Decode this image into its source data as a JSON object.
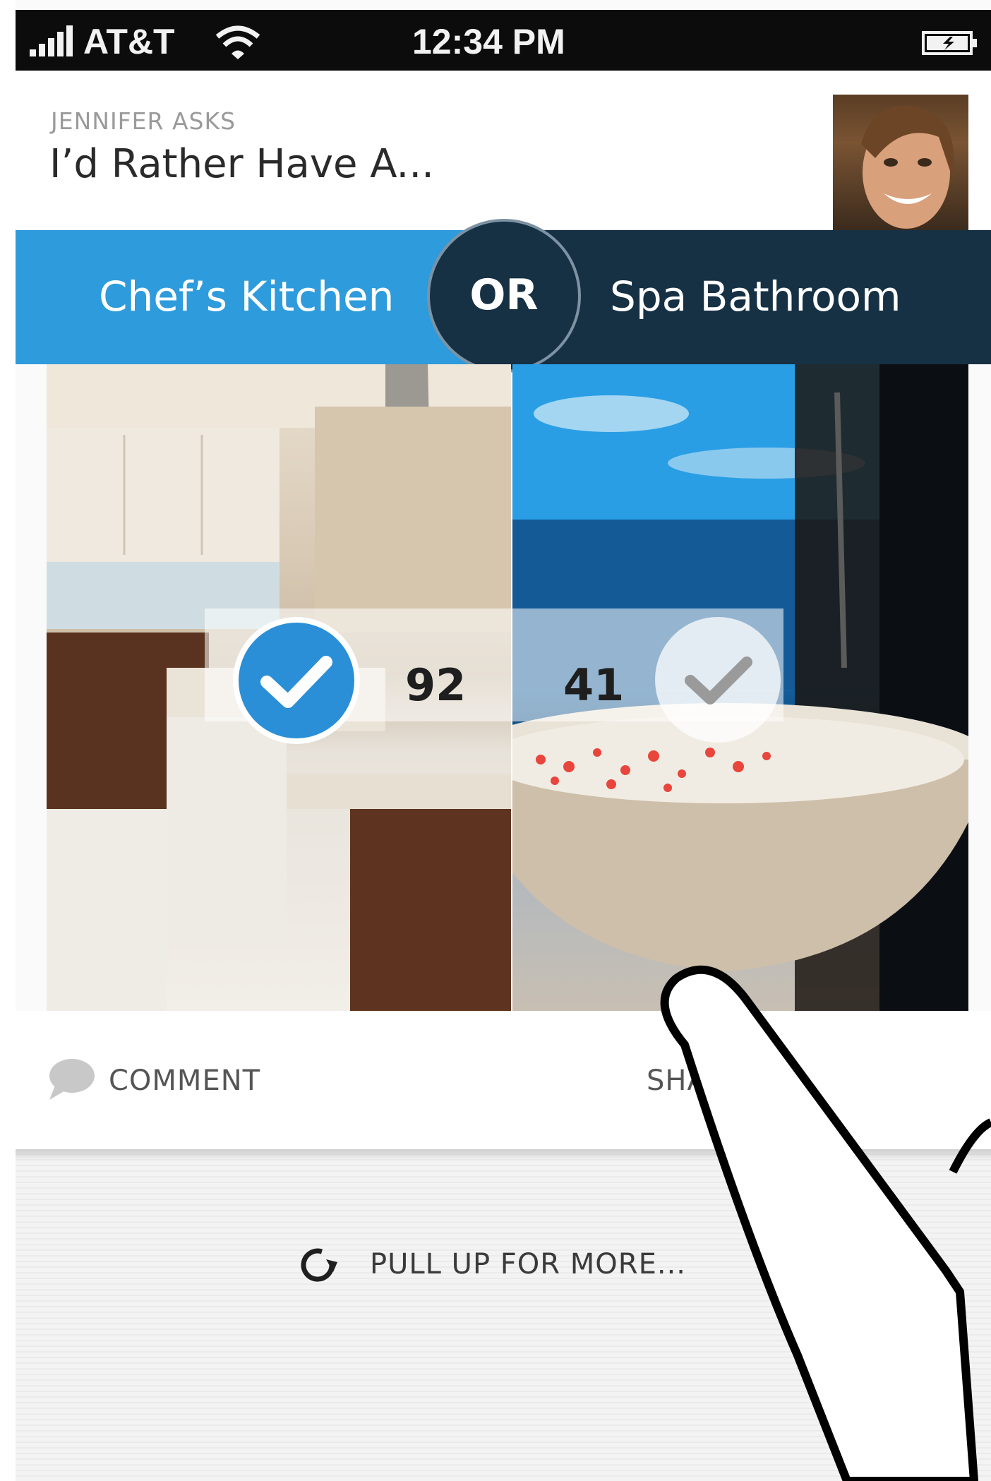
{
  "status_bar": {
    "carrier": "AT&T",
    "time": "12:34 PM",
    "icons": [
      "signal-icon",
      "wifi-icon",
      "battery-charging-icon"
    ]
  },
  "question": {
    "asker": "JENNIFER ASKS",
    "title": "I’d Rather Have A..."
  },
  "choices": {
    "left_label": "Chef’s Kitchen",
    "or_label": "OR",
    "right_label": "Spa Bathroom",
    "left_votes": "92",
    "right_votes": "41",
    "selected": "left"
  },
  "actions": {
    "comment_label": "COMMENT",
    "share_label": "SHARE"
  },
  "footer": {
    "pull_label": "PULL UP FOR MORE..."
  },
  "colors": {
    "accent_blue": "#2e9bdc",
    "dark_navy": "#163044"
  }
}
